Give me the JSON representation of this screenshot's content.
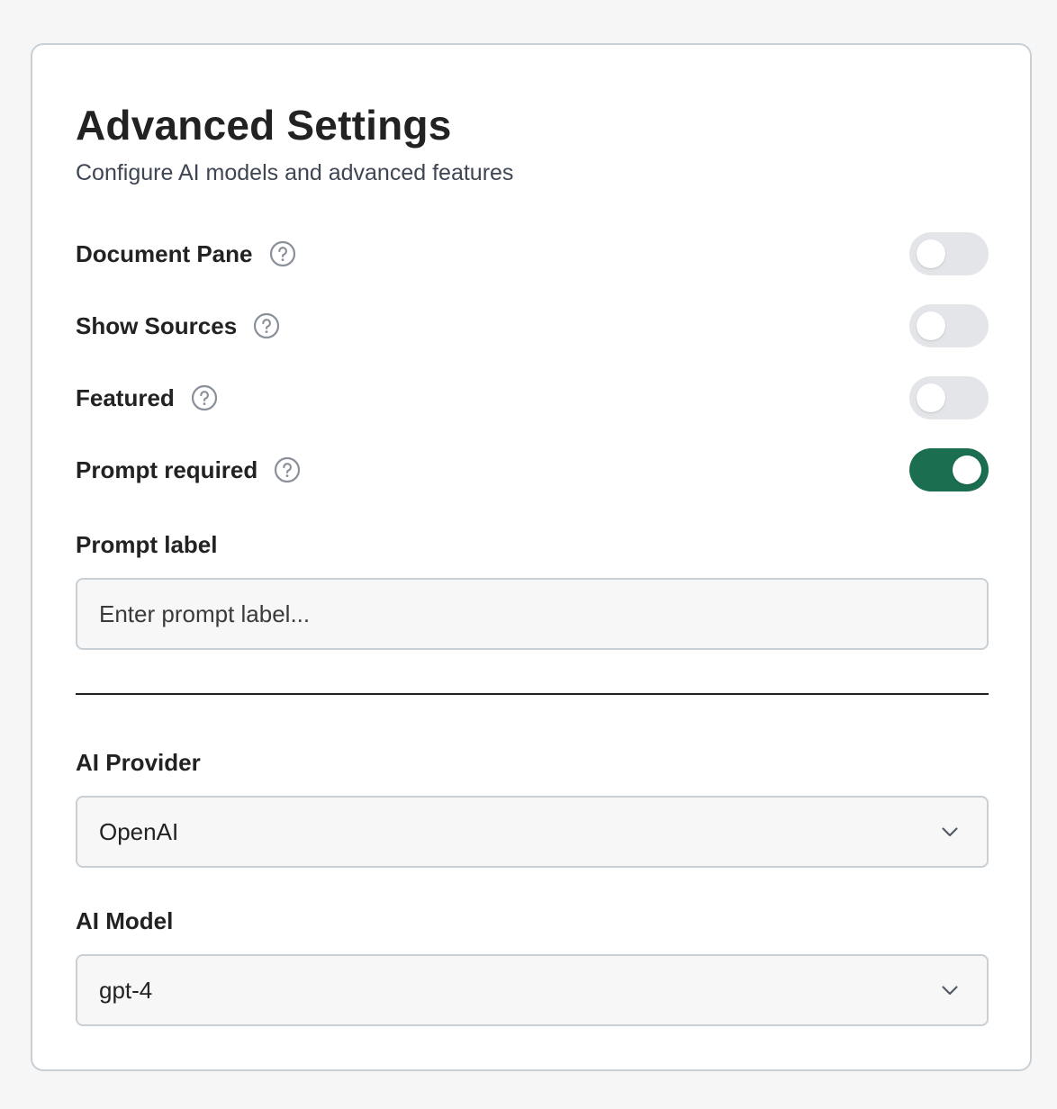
{
  "header": {
    "title": "Advanced Settings",
    "subtitle": "Configure AI models and advanced features"
  },
  "toggles": [
    {
      "label": "Document Pane",
      "on": false
    },
    {
      "label": "Show Sources",
      "on": false
    },
    {
      "label": "Featured",
      "on": false
    },
    {
      "label": "Prompt required",
      "on": true
    }
  ],
  "prompt_label": {
    "label": "Prompt label",
    "placeholder": "Enter prompt label...",
    "value": ""
  },
  "ai_provider": {
    "label": "AI Provider",
    "selected": "OpenAI"
  },
  "ai_model": {
    "label": "AI Model",
    "selected": "gpt-4"
  },
  "colors": {
    "toggle_on": "#1b6e4f",
    "toggle_off": "#e3e5e8",
    "border": "#c8d0d6",
    "icon": "#8a9099"
  },
  "icons": {
    "help": "question-circle-icon",
    "select": "chevron-down-icon"
  }
}
